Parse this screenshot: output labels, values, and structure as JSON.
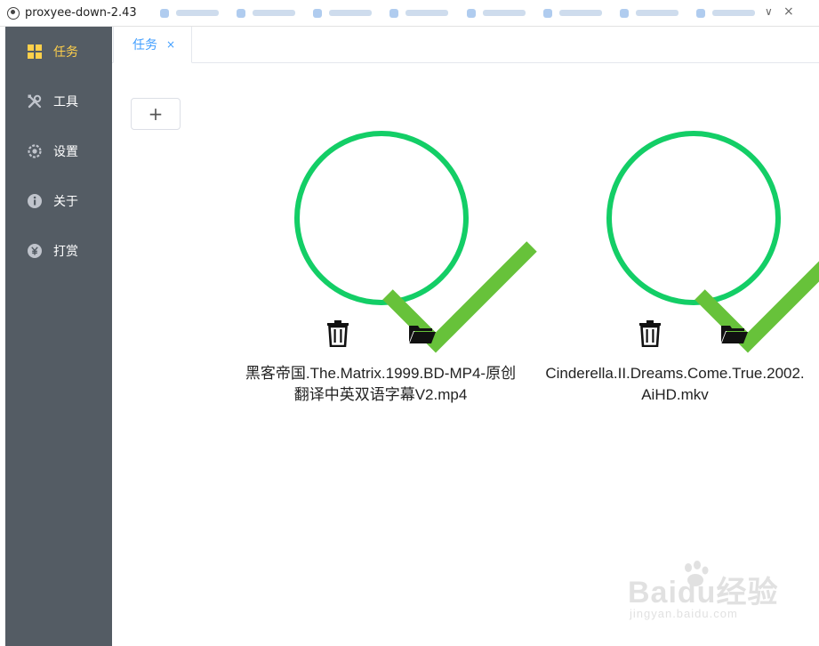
{
  "window": {
    "title": "proxyee-down-2.43"
  },
  "sidebar": {
    "items": [
      {
        "label": "任务",
        "icon": "grid-icon",
        "active": true
      },
      {
        "label": "工具",
        "icon": "tools-icon",
        "active": false
      },
      {
        "label": "设置",
        "icon": "gear-icon",
        "active": false
      },
      {
        "label": "关于",
        "icon": "info-icon",
        "active": false
      },
      {
        "label": "打赏",
        "icon": "yen-icon",
        "active": false
      }
    ],
    "colors": {
      "background": "#545c64",
      "text": "#ffffff",
      "active_text": "#ffd04b"
    }
  },
  "tabs": [
    {
      "label": "任务",
      "close": "×"
    }
  ],
  "toolbar": {
    "add_label": "+"
  },
  "tasks": [
    {
      "status": "completed",
      "progress": 1.0,
      "filename_line1": "黑客帝国.The.Matrix.1999.BD-MP4-原创",
      "filename_line2": "翻译中英双语字幕V2.mp4"
    },
    {
      "status": "completed",
      "progress": 1.0,
      "filename_line1": "Cinderella.II.Dreams.Come.True.2002.",
      "filename_line2": "AiHD.mkv"
    }
  ],
  "colors": {
    "progress_ring": "#13ce66",
    "check": "#67c23a",
    "accent": "#409eff"
  },
  "watermark": {
    "brand": "Baidu经验",
    "site": "jingyan.baidu.com"
  }
}
